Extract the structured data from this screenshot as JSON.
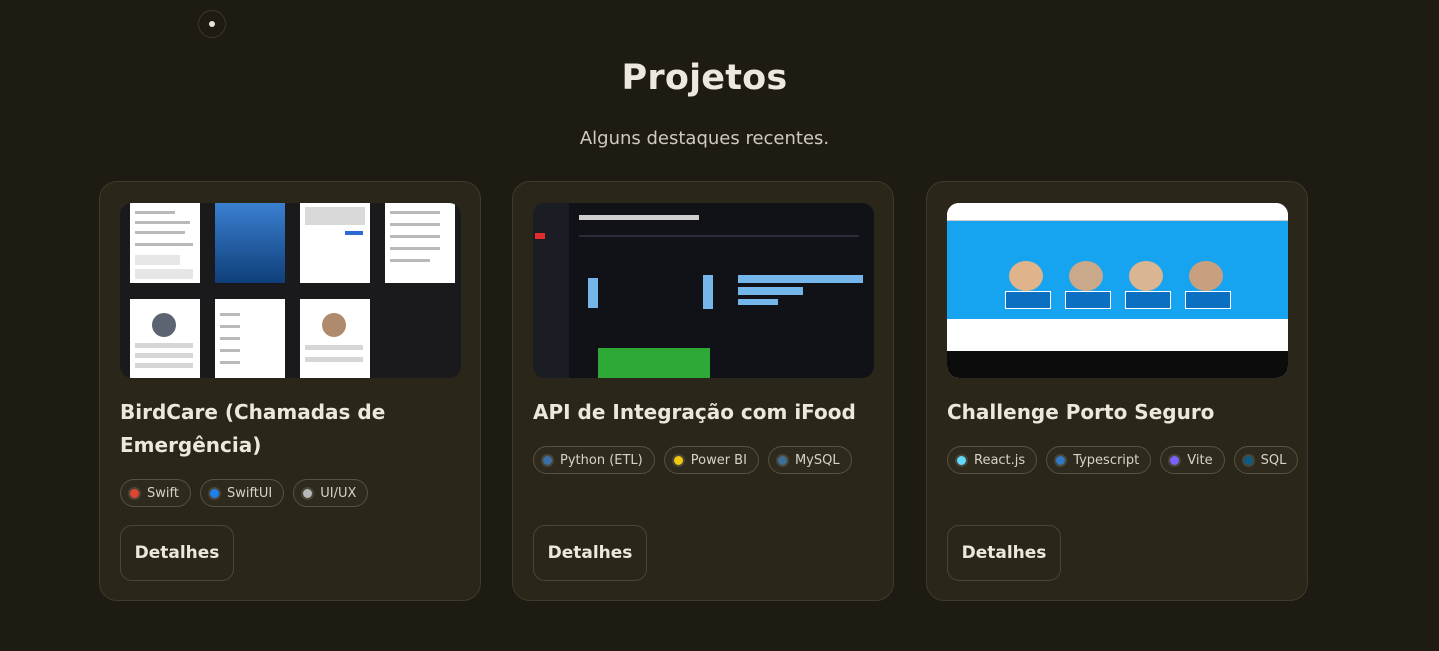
{
  "section": {
    "title": "Projetos",
    "subtitle": "Alguns destaques recentes."
  },
  "colors": {
    "background": "#1e1b12",
    "card": "#2a2619",
    "card_border": "#3e3a2c"
  },
  "projects": [
    {
      "name": "BirdCare (Chamadas de Emergência)",
      "screenshot_icon": "birdcare-app-screens",
      "tags": [
        {
          "label": "Swift",
          "color": "#e2452f"
        },
        {
          "label": "SwiftUI",
          "color": "#1e7ff0"
        },
        {
          "label": "UI/UX",
          "color": "#b8b8b8"
        }
      ],
      "button": "Detalhes"
    },
    {
      "name": "API de Integração com iFood",
      "screenshot_icon": "ifood-dashboard",
      "tags": [
        {
          "label": "Python (ETL)",
          "color": "#3b6ea5"
        },
        {
          "label": "Power BI",
          "color": "#f2c811"
        },
        {
          "label": "MySQL",
          "color": "#3d6e96"
        }
      ],
      "button": "Detalhes"
    },
    {
      "name": "Challenge Porto Seguro",
      "screenshot_icon": "porto-seguro-site",
      "tags": [
        {
          "label": "React.js",
          "color": "#61dafb"
        },
        {
          "label": "Typescript",
          "color": "#3178c6"
        },
        {
          "label": "Vite",
          "color": "#7b61ff"
        },
        {
          "label": "SQL",
          "color": "#0e5b85"
        }
      ],
      "button": "Detalhes"
    }
  ]
}
